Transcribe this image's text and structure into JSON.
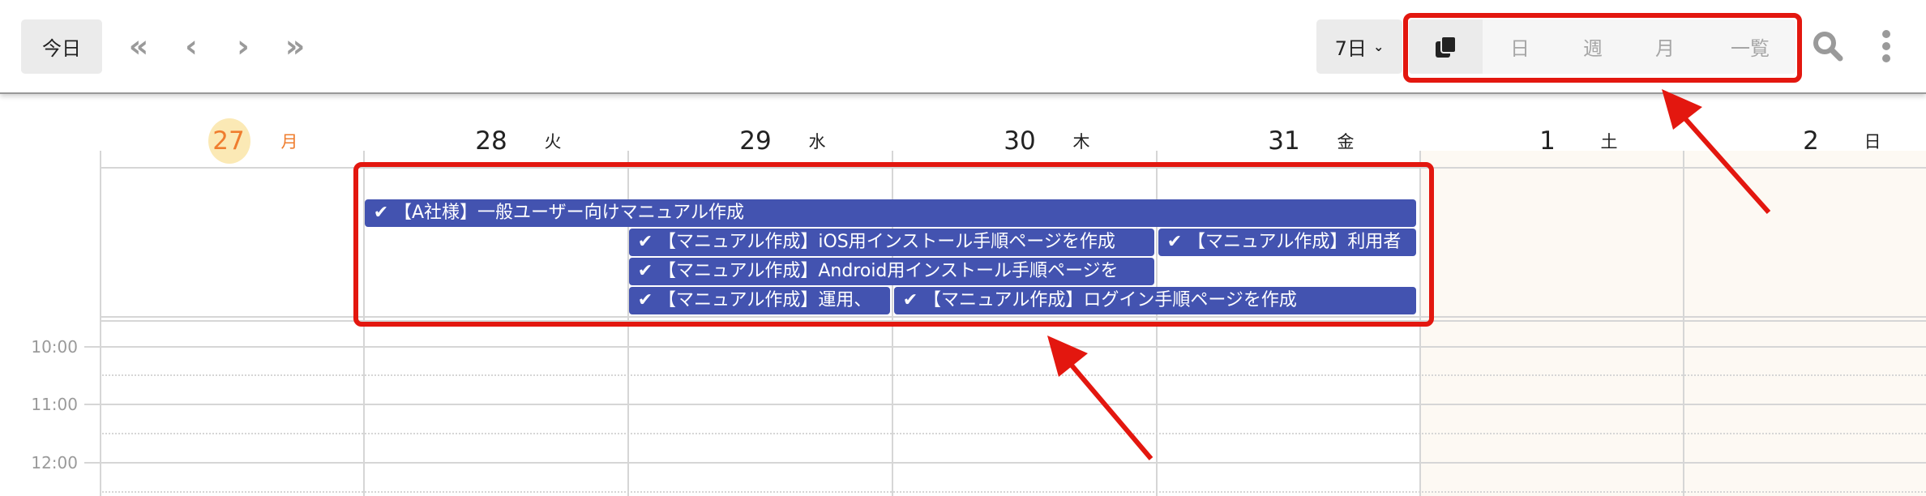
{
  "toolbar": {
    "today_label": "今日",
    "nav_icons": [
      "chevron-double-left-icon",
      "chevron-left-icon",
      "chevron-right-icon",
      "chevron-double-right-icon"
    ],
    "range_select": "7日",
    "view_tabs": [
      {
        "label": "",
        "icon": "copy-icon",
        "active": true
      },
      {
        "label": "日",
        "active": false
      },
      {
        "label": "週",
        "active": false
      },
      {
        "label": "月",
        "active": false
      },
      {
        "label": "一覧",
        "active": false
      }
    ]
  },
  "days": [
    {
      "num": "27",
      "weekday": "月",
      "today": true
    },
    {
      "num": "28",
      "weekday": "火"
    },
    {
      "num": "29",
      "weekday": "水"
    },
    {
      "num": "30",
      "weekday": "木"
    },
    {
      "num": "31",
      "weekday": "金"
    },
    {
      "num": "1",
      "weekday": "土",
      "weekend": true
    },
    {
      "num": "2",
      "weekday": "日",
      "weekend": true
    }
  ],
  "times": [
    "10:00",
    "11:00",
    "12:00"
  ],
  "events": [
    {
      "title": "【A社様】一般ユーザー向けマニュアル作成",
      "completed": true
    },
    {
      "title": "【マニュアル作成】iOS用インストール手順ページを作成",
      "completed": true
    },
    {
      "title": "【マニュアル作成】利用者",
      "completed": true
    },
    {
      "title": "【マニュアル作成】Android用インストール手順ページを",
      "completed": true
    },
    {
      "title": "【マニュアル作成】運用、",
      "completed": true
    },
    {
      "title": "【マニュアル作成】ログイン手順ページを作成",
      "completed": true
    }
  ],
  "colors": {
    "event": "#4353b0",
    "today_text": "#ef7d2e",
    "today_circle": "#fbe9b5",
    "weekend_bg": "#fdf9f3",
    "annotation": "#e3170f"
  }
}
